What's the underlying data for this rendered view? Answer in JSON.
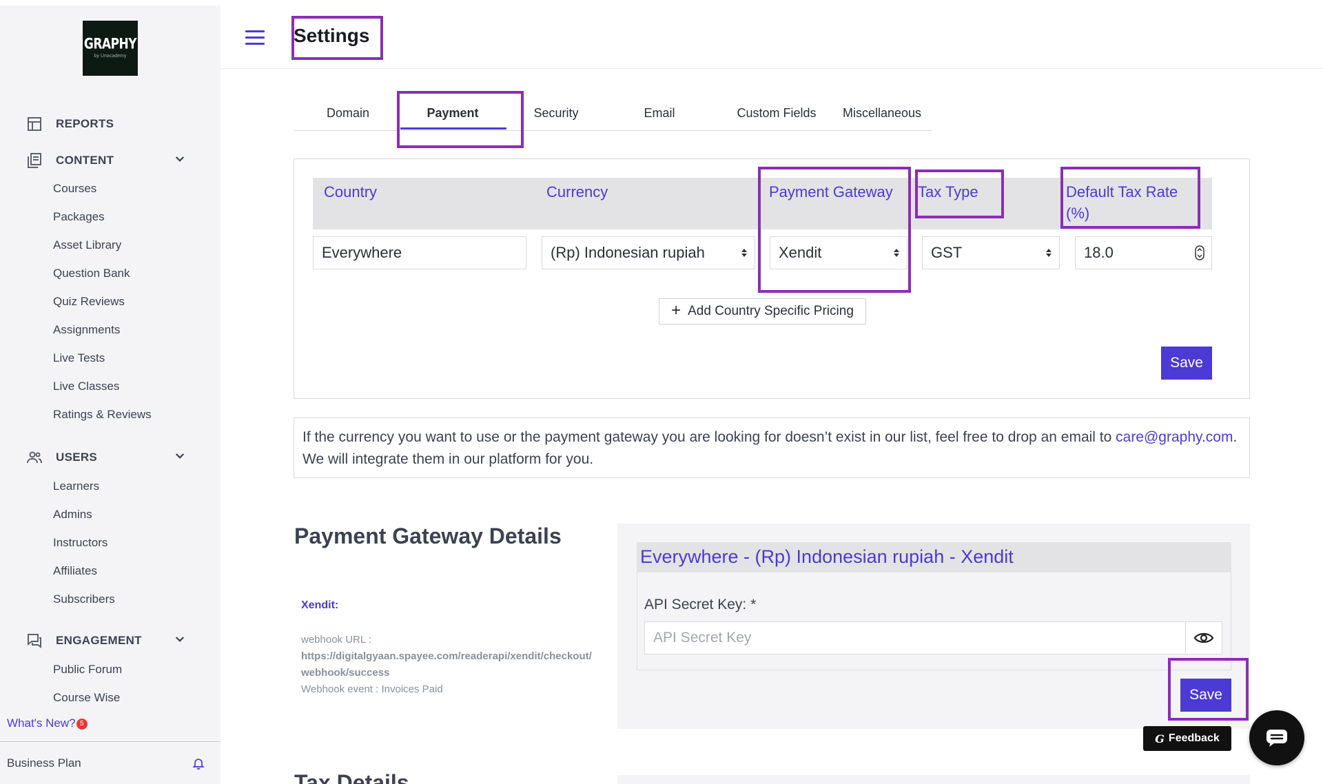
{
  "sidebar": {
    "logo_big": "GRAPHY",
    "logo_small": "by Unacademy",
    "reports": "REPORTS",
    "content": {
      "label": "CONTENT",
      "items": [
        "Courses",
        "Packages",
        "Asset Library",
        "Question Bank",
        "Quiz Reviews",
        "Assignments",
        "Live Tests",
        "Live Classes",
        "Ratings & Reviews"
      ]
    },
    "users": {
      "label": "USERS",
      "items": [
        "Learners",
        "Admins",
        "Instructors",
        "Affiliates",
        "Subscribers"
      ]
    },
    "engagement": {
      "label": "ENGAGEMENT",
      "items": [
        "Public Forum",
        "Course Wise"
      ]
    },
    "whats_new": "What's New?",
    "whats_new_badge": "5",
    "plan": "Business Plan"
  },
  "header": {
    "title": "Settings"
  },
  "tabs": [
    {
      "label": "Domain",
      "active": false
    },
    {
      "label": "Payment",
      "active": true
    },
    {
      "label": "Security",
      "active": false
    },
    {
      "label": "Email",
      "active": false
    },
    {
      "label": "Custom Fields",
      "active": false
    },
    {
      "label": "Miscellaneous",
      "active": false
    }
  ],
  "pricing": {
    "headers": {
      "country": "Country",
      "currency": "Currency",
      "gateway": "Payment Gateway",
      "tax_type": "Tax Type",
      "tax_rate": "Default Tax Rate (%)"
    },
    "row": {
      "country": "Everywhere",
      "currency": "(Rp) Indonesian rupiah",
      "gateway": "Xendit",
      "tax_type": "GST",
      "tax_rate": "18.0"
    },
    "add_label": "Add Country Specific Pricing",
    "save_label": "Save"
  },
  "notice": {
    "text_before": "If the currency you want to use or the payment gateway you are looking for doesn’t exist in our list, feel free to drop an email to ",
    "email": "care@graphy.com",
    "text_after": ". We will integrate them in our platform for you."
  },
  "gateway_details": {
    "title": "Payment Gateway Details",
    "name": "Xendit:",
    "webhook_label": "webhook URL :",
    "webhook_url": "https://digitalgyaan.spayee.com/readerapi/xendit/checkout/webhook/success",
    "webhook_event": "Webhook event : Invoices Paid",
    "card_title": "Everywhere - (Rp) Indonesian rupiah - Xendit",
    "api_label": "API Secret Key: *",
    "api_placeholder": "API Secret Key",
    "save_label": "Save"
  },
  "tax_details_title": "Tax Details",
  "feedback_label": "Feedback",
  "colors": {
    "accent": "#4b3ad4",
    "highlight": "#8a2db8",
    "sidebar_bg": "#f4f4f6"
  }
}
